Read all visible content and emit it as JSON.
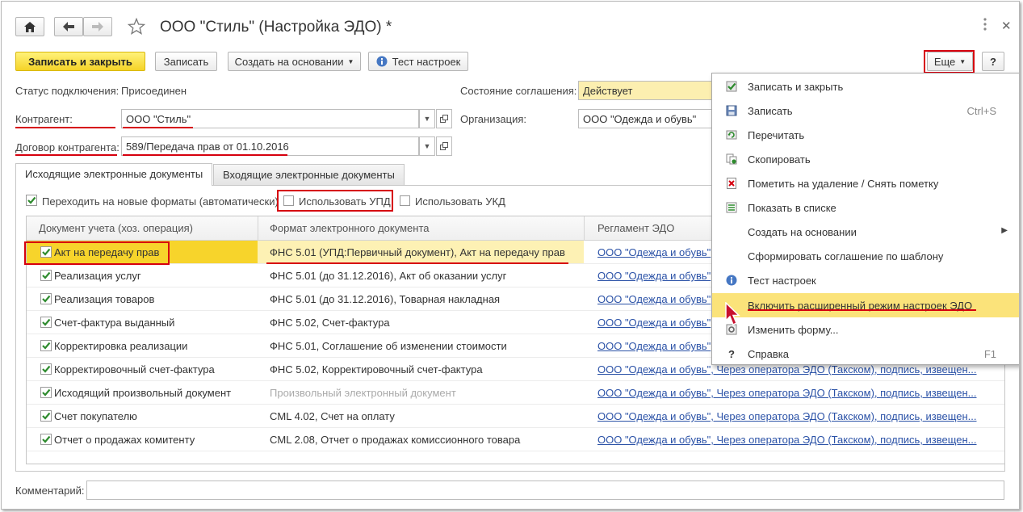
{
  "window": {
    "title": "ООО \"Стиль\" (Настройка ЭДО) *",
    "home_icon": "home-icon",
    "back_icon": "arrow-left-icon",
    "forward_icon": "arrow-right-icon",
    "star_icon": "star-icon",
    "more_icon": "more-vertical-icon",
    "close_icon": "close-icon"
  },
  "toolbar": {
    "save_close": "Записать и закрыть",
    "save": "Записать",
    "create_based": "Создать на основании",
    "test": "Тест настроек",
    "more": "Еще",
    "help": "?"
  },
  "form": {
    "status_label": "Статус подключения:",
    "status_value": "Присоединен",
    "agreement_label": "Состояние соглашения:",
    "agreement_value": "Действует",
    "counterparty_label": "Контрагент:",
    "counterparty_value": "ООО \"Стиль\"",
    "organization_label": "Организация:",
    "organization_value": "ООО \"Одежда и обувь\"",
    "contract_label": "Договор контрагента:",
    "contract_value": "589/Передача прав от 01.10.2016",
    "comment_label": "Комментарий:",
    "comment_value": ""
  },
  "tabs": [
    {
      "label": "Исходящие электронные документы",
      "active": true
    },
    {
      "label": "Входящие электронные документы",
      "active": false
    }
  ],
  "options": {
    "new_formats": {
      "label": "Переходить на новые форматы (автоматически)",
      "checked": true
    },
    "use_upd": {
      "label": "Использовать УПД",
      "checked": false
    },
    "use_ukd": {
      "label": "Использовать УКД",
      "checked": false
    }
  },
  "table": {
    "columns": [
      "Документ учета (хоз. операция)",
      "Формат электронного документа",
      "Регламент ЭДО"
    ],
    "rows": [
      {
        "doc": "Акт на передачу прав",
        "format": "ФНС 5.01 (УПД:Первичный документ), Акт на передачу прав",
        "reg": "ООО \"Одежда и обувь\"",
        "selected": true,
        "checked": true
      },
      {
        "doc": "Реализация услуг",
        "format": "ФНС 5.01 (до 31.12.2016), Акт об оказании услуг",
        "reg": "ООО \"Одежда и обувь\"",
        "checked": true
      },
      {
        "doc": "Реализация товаров",
        "format": "ФНС 5.01 (до 31.12.2016), Товарная накладная",
        "reg": "ООО \"Одежда и обувь\"",
        "checked": true
      },
      {
        "doc": "Счет-фактура выданный",
        "format": "ФНС 5.02, Счет-фактура",
        "reg": "ООО \"Одежда и обувь\"",
        "checked": true
      },
      {
        "doc": "Корректировка реализации",
        "format": "ФНС 5.01, Соглашение об изменении стоимости",
        "reg": "ООО \"Одежда и обувь\"",
        "checked": true
      },
      {
        "doc": "Корректировочный счет-фактура",
        "format": "ФНС 5.02, Корректировочный счет-фактура",
        "reg": "ООО \"Одежда и обувь\", Через оператора ЭДО (Такском), подпись, извещен...",
        "checked": true
      },
      {
        "doc": "Исходящий произвольный документ",
        "format": "Произвольный электронный документ",
        "format_grey": true,
        "reg": "ООО \"Одежда и обувь\", Через оператора ЭДО (Такском), подпись, извещен...",
        "checked": true
      },
      {
        "doc": "Счет покупателю",
        "format": "CML 4.02, Счет на оплату",
        "reg": "ООО \"Одежда и обувь\", Через оператора ЭДО (Такском), подпись, извещен...",
        "checked": true
      },
      {
        "doc": "Отчет о продажах комитенту",
        "format": "CML 2.08, Отчет о продажах комиссионного товара",
        "reg": "ООО \"Одежда и обувь\", Через оператора ЭДО (Такском), подпись, извещен...",
        "checked": true
      }
    ]
  },
  "menu": {
    "items": [
      {
        "label": "Записать и закрыть",
        "icon": "save-close-icon",
        "shortcut": ""
      },
      {
        "label": "Записать",
        "icon": "floppy-disk-icon",
        "shortcut": "Ctrl+S"
      },
      {
        "label": "Перечитать",
        "icon": "reread-icon",
        "shortcut": ""
      },
      {
        "label": "Скопировать",
        "icon": "copy-icon",
        "shortcut": ""
      },
      {
        "label": "Пометить на удаление / Снять пометку",
        "icon": "delete-mark-icon",
        "shortcut": ""
      },
      {
        "label": "Показать в списке",
        "icon": "show-in-list-icon",
        "shortcut": ""
      },
      {
        "label": "Создать на основании",
        "icon": "",
        "shortcut": "",
        "submenu": true
      },
      {
        "label": "Сформировать соглашение по шаблону",
        "icon": "",
        "shortcut": ""
      },
      {
        "label": "Тест настроек",
        "icon": "info-icon",
        "shortcut": ""
      },
      {
        "label": "Включить расширенный режим настроек ЭДО",
        "icon": "",
        "shortcut": "",
        "highlighted": true
      },
      {
        "label": "Изменить форму...",
        "icon": "settings-form-icon",
        "shortcut": ""
      },
      {
        "label": "Справка",
        "icon": "help-icon",
        "shortcut": "F1"
      }
    ]
  },
  "colors": {
    "accent_yellow": "#f5d327",
    "highlight": "#fbe37a",
    "annotation_red": "#d6000e",
    "link_blue": "#2b52a7",
    "check_green": "#2e8b2e"
  }
}
